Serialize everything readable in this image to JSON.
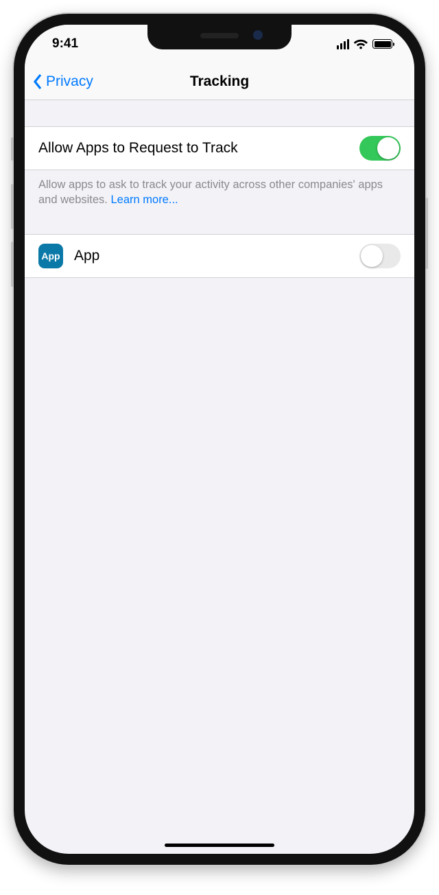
{
  "status": {
    "time": "9:41"
  },
  "nav": {
    "back": "Privacy",
    "title": "Tracking"
  },
  "main": {
    "allow_label": "Allow Apps to Request to Track",
    "allow_on": true,
    "footer_text": "Allow apps to ask to track your activity across other companies' apps and websites. ",
    "learn_more": "Learn more...",
    "app": {
      "icon_text": "App",
      "name": "App",
      "allowed": false
    }
  }
}
